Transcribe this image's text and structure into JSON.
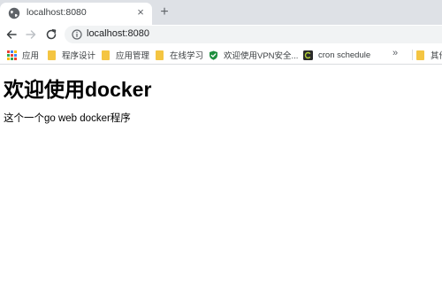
{
  "tab": {
    "title": "localhost:8080",
    "favicon_icon": "globe-icon",
    "close_symbol": "×",
    "new_tab_symbol": "+"
  },
  "toolbar": {
    "back_icon": "arrow-left-icon",
    "forward_icon": "arrow-right-icon",
    "reload_icon": "reload-icon",
    "url": "localhost:8080",
    "info_icon": "info-icon"
  },
  "bookmarks": {
    "items": [
      {
        "label": "应用",
        "icon": "apps-grid-icon"
      },
      {
        "label": "程序设计",
        "icon": "folder-icon"
      },
      {
        "label": "应用管理",
        "icon": "folder-icon"
      },
      {
        "label": "在线学习",
        "icon": "folder-icon"
      },
      {
        "label": "欢迎使用VPN安全...",
        "icon": "shield-check-icon"
      },
      {
        "label": "cron schedule",
        "icon": "cron-icon"
      },
      {
        "label": "其他",
        "icon": "folder-icon"
      }
    ],
    "more_symbol": "»"
  },
  "page": {
    "heading": "欢迎使用docker",
    "text": "这个一个go web docker程序"
  },
  "colors": {
    "tabstrip": "#dee1e6",
    "omnibox": "#f1f3f4",
    "folder": "#f4c542",
    "shield": "#1e8e3e"
  }
}
